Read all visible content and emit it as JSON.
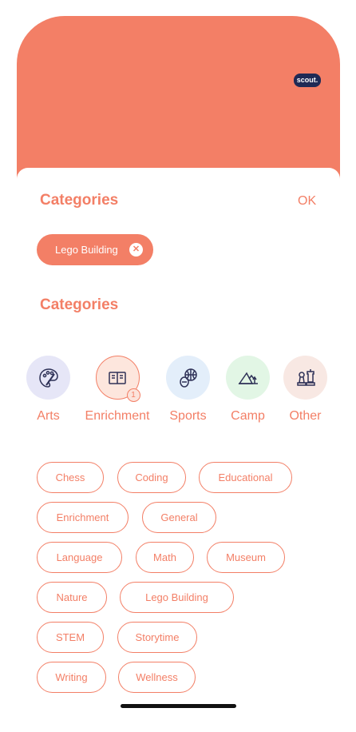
{
  "header": {
    "logo_text": "scout.",
    "color": "#F37F66"
  },
  "panel": {
    "title": "Categories",
    "ok_label": "OK",
    "selected": [
      {
        "label": "Lego Building",
        "remove_icon": "close-icon"
      }
    ],
    "section_title": "Categories"
  },
  "categories": [
    {
      "label": "Arts",
      "icon": "palette-icon"
    },
    {
      "label": "Enrichment",
      "icon": "book-icon",
      "badge": "1"
    },
    {
      "label": "Sports",
      "icon": "sports-balls-icon"
    },
    {
      "label": "Camp",
      "icon": "tent-icon"
    },
    {
      "label": "Other",
      "icon": "chess-icon"
    }
  ],
  "tags": [
    "Chess",
    "Coding",
    "Educational",
    "Enrichment",
    "General",
    "Language",
    "Math",
    "Museum",
    "Nature",
    "Lego Building",
    "STEM",
    "Storytime",
    "Writing",
    "Wellness"
  ]
}
